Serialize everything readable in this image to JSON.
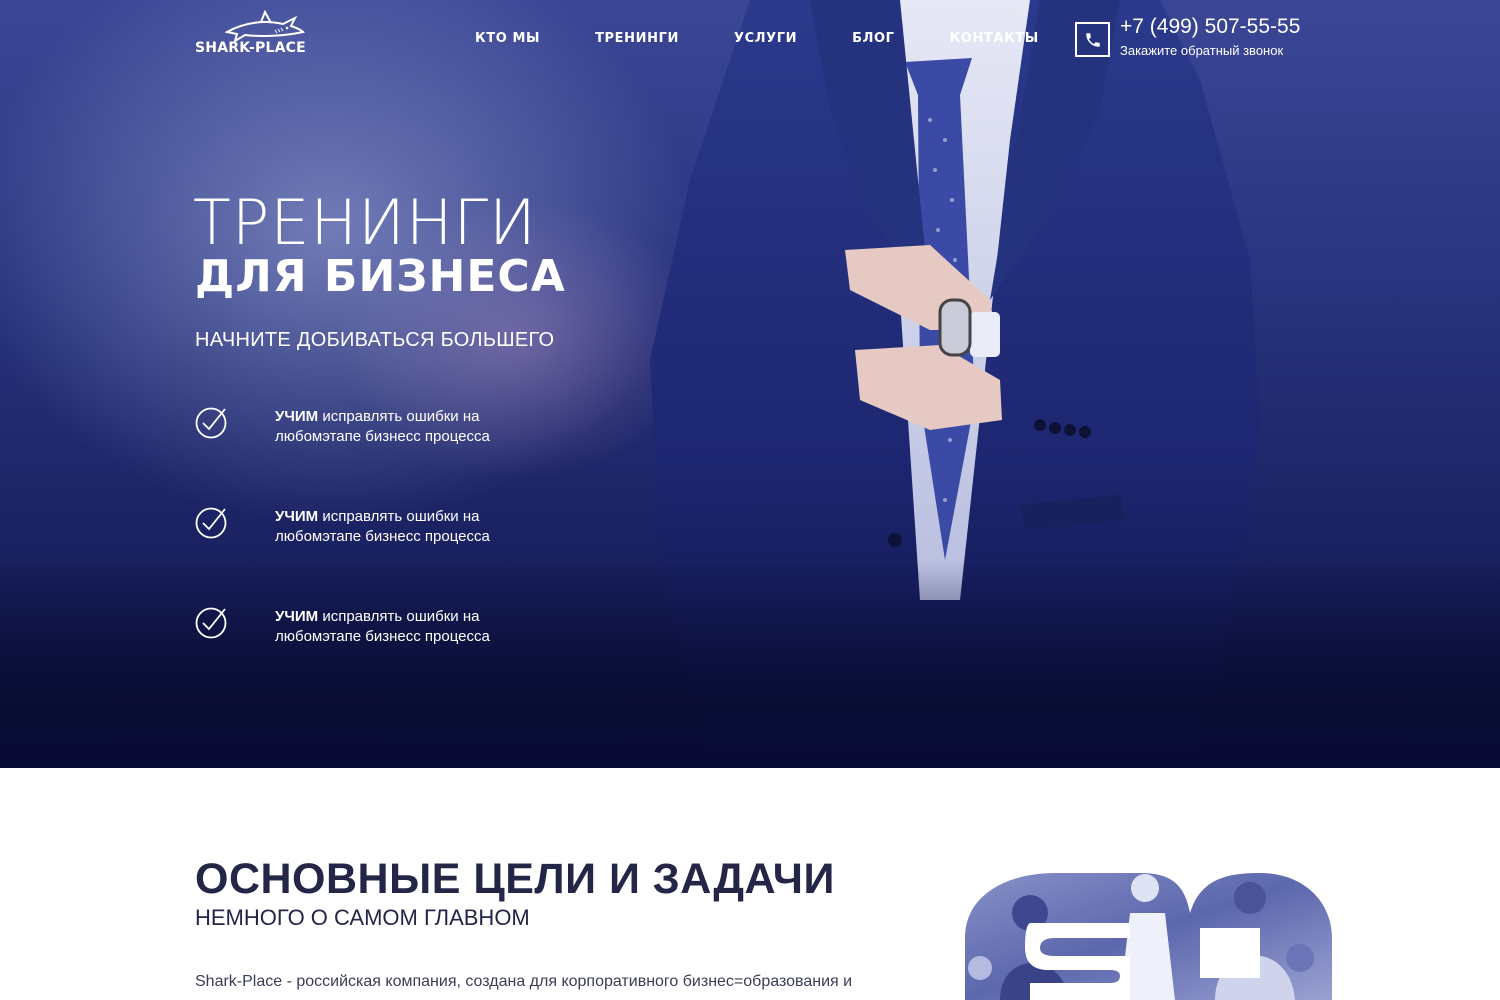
{
  "header": {
    "logo_text": "SHARK-PLACE",
    "nav": [
      "КТО МЫ",
      "ТРЕНИНГИ",
      "УСЛУГИ",
      "БЛОГ",
      "КОНТАКТЫ"
    ],
    "phone": "+7 (499) 507-55-55",
    "callback": "Закажите обратный звонок"
  },
  "hero": {
    "title_line1": "ТРЕНИНГИ",
    "title_line2": "ДЛЯ БИЗНЕСА",
    "subtitle": "НАЧНИТЕ ДОБИВАТЬСЯ БОЛЬШЕГО",
    "features": [
      {
        "bold": "УЧИМ",
        "text": " исправлять ошибки на любомэтапе бизнесс процесса"
      },
      {
        "bold": "УЧИМ",
        "text": " исправлять ошибки на любомэтапе бизнесс процесса"
      },
      {
        "bold": "УЧИМ",
        "text": " исправлять ошибки на любомэтапе бизнесс процесса"
      }
    ]
  },
  "goals": {
    "title": "ОСНОВНЫЕ ЦЕЛИ И ЗАДАЧИ",
    "subtitle": "НЕМНОГО О САМОМ ГЛАВНОМ",
    "body": "Shark-Place - российская компания, создана для корпоративного бизнес=образования и"
  },
  "colors": {
    "hero_dark": "#0b0f3a",
    "hero_mid": "#2a3580",
    "heading": "#232646",
    "white": "#ffffff"
  },
  "icons": {
    "logo": "shark-icon",
    "phone": "phone-icon",
    "feature": "check-circle-icon"
  }
}
